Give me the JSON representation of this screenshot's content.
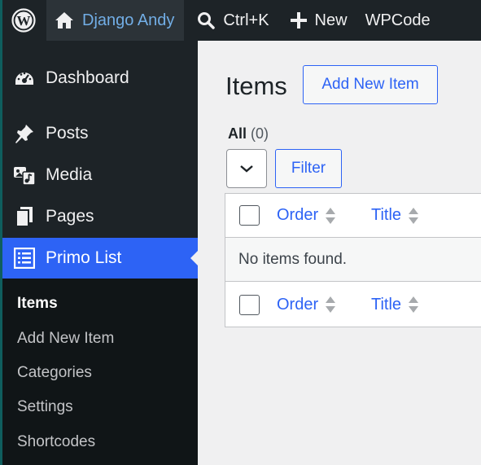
{
  "adminbar": {
    "site_name": "Django Andy",
    "search_label": "Ctrl+K",
    "new_label": "New",
    "wpcode_label": "WPCode"
  },
  "sidebar": {
    "items": [
      {
        "label": "Dashboard",
        "icon": "dashboard-icon"
      },
      {
        "label": "Posts",
        "icon": "pin-icon"
      },
      {
        "label": "Media",
        "icon": "media-icon"
      },
      {
        "label": "Pages",
        "icon": "pages-icon"
      },
      {
        "label": "Primo List",
        "icon": "list-icon",
        "active": true
      }
    ],
    "submenu": [
      "Items",
      "Add New Item",
      "Categories",
      "Settings",
      "Shortcodes"
    ]
  },
  "main": {
    "title": "Items",
    "add_new_label": "Add New Item",
    "views_all": "All",
    "views_count": "(0)",
    "filter_label": "Filter",
    "columns": [
      "Order",
      "Title"
    ],
    "empty_message": "No items found."
  },
  "colors": {
    "accent": "#2d63f5",
    "adminbar_bg": "#1d2327",
    "submenu_bg": "#101517",
    "content_bg": "#f0f0f1"
  }
}
